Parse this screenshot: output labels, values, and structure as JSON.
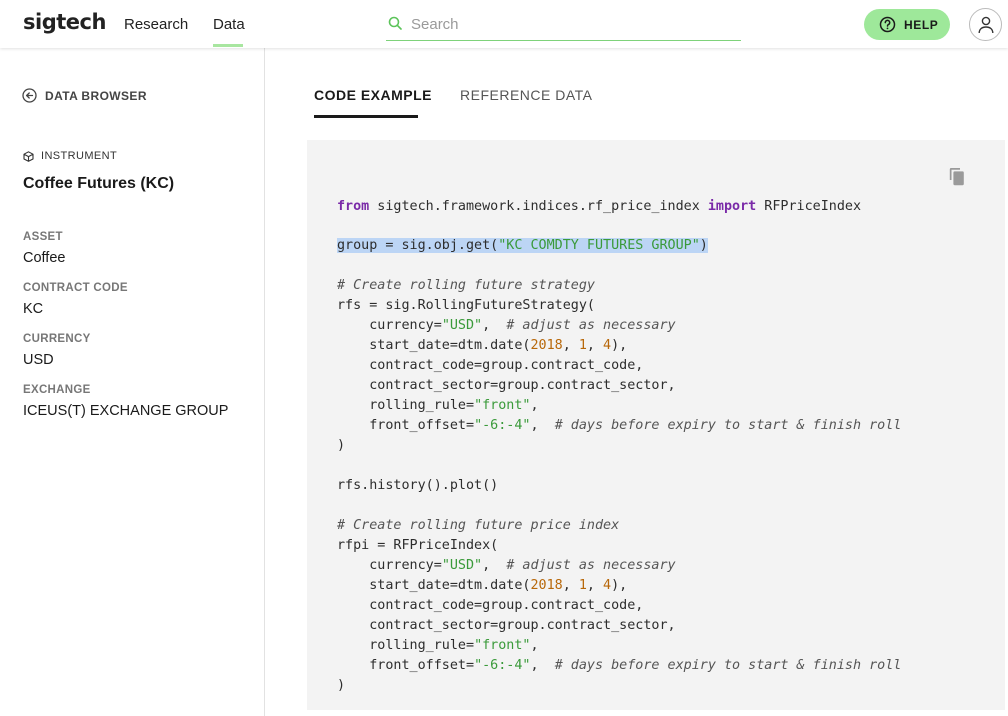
{
  "header": {
    "logo": "sigtech",
    "nav": [
      {
        "label": "Research"
      },
      {
        "label": "Data"
      }
    ],
    "search_placeholder": "Search",
    "help_label": "HELP",
    "colors": {
      "accent": "#9ee89a",
      "search_underline": "#7ed27a"
    }
  },
  "sidebar": {
    "back_label": "DATA BROWSER",
    "instrument_tag": "INSTRUMENT",
    "instrument_title": "Coffee Futures (KC)",
    "fields": [
      {
        "label": "ASSET",
        "value": "Coffee"
      },
      {
        "label": "CONTRACT CODE",
        "value": "KC"
      },
      {
        "label": "CURRENCY",
        "value": "USD"
      },
      {
        "label": "EXCHANGE",
        "value": "ICEUS(T) EXCHANGE GROUP"
      }
    ]
  },
  "main": {
    "tabs": [
      {
        "label": "CODE EXAMPLE",
        "active": true
      },
      {
        "label": "REFERENCE DATA",
        "active": false
      }
    ],
    "code": {
      "l1": {
        "kw1": "from",
        "mod": " sigtech.framework.indices.rf_price_index ",
        "kw2": "import",
        "name": " RFPriceIndex"
      },
      "l2": {
        "pre": "group = sig.obj.get(",
        "str": "\"KC COMDTY FUTURES GROUP\"",
        "post": ")"
      },
      "l3": "# Create rolling future strategy",
      "l4": "rfs = sig.RollingFutureStrategy(",
      "l5": {
        "pre": "    currency=",
        "str": "\"USD\"",
        "mid": ",  ",
        "com": "# adjust as necessary"
      },
      "l6": {
        "pre": "    start_date=dtm.date(",
        "n1": "2018",
        "s1": ", ",
        "n2": "1",
        "s2": ", ",
        "n3": "4",
        "post": "),"
      },
      "l7": "    contract_code=group.contract_code,",
      "l8": "    contract_sector=group.contract_sector,",
      "l9": {
        "pre": "    rolling_rule=",
        "str": "\"front\"",
        "post": ","
      },
      "l10": {
        "pre": "    front_offset=",
        "str": "\"-6:-4\"",
        "mid": ",  ",
        "com": "# days before expiry to start & finish roll"
      },
      "l11": ")",
      "l12": "rfs.history().plot()",
      "l13": "# Create rolling future price index",
      "l14": "rfpi = RFPriceIndex(",
      "l15": {
        "pre": "    currency=",
        "str": "\"USD\"",
        "mid": ",  ",
        "com": "# adjust as necessary"
      },
      "l16": {
        "pre": "    start_date=dtm.date(",
        "n1": "2018",
        "s1": ", ",
        "n2": "1",
        "s2": ", ",
        "n3": "4",
        "post": "),"
      },
      "l17": "    contract_code=group.contract_code,",
      "l18": "    contract_sector=group.contract_sector,",
      "l19": {
        "pre": "    rolling_rule=",
        "str": "\"front\"",
        "post": ","
      },
      "l20": {
        "pre": "    front_offset=",
        "str": "\"-6:-4\"",
        "mid": ",  ",
        "com": "# days before expiry to start & finish roll"
      },
      "l21": ")"
    }
  }
}
